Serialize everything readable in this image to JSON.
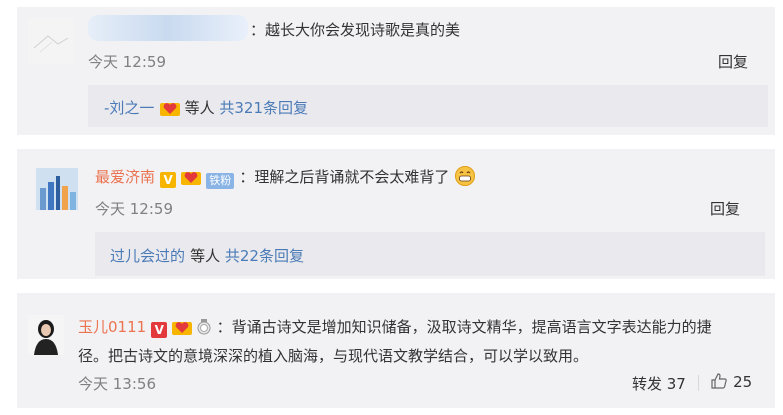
{
  "comments": [
    {
      "author": "",
      "text": "：越长大你会发现诗歌是真的美",
      "time": "今天 12:59",
      "reply_button": "回复",
      "replies_by": "-刘之一",
      "replies_mid": " 等人 ",
      "replies_count": "共321条回复"
    },
    {
      "author": "最爱济南",
      "badge_v": "V",
      "badge_fan": "铁粉",
      "text": "：理解之后背诵就不会太难背了",
      "time": "今天 12:59",
      "reply_button": "回复",
      "replies_by": "过儿会过的",
      "replies_mid": " 等人 ",
      "replies_count": "共22条回复"
    },
    {
      "author": "玉儿0111",
      "badge_v": "V",
      "text_line1": "：背诵古诗文是增加知识储备，汲取诗文精华，提高语言文字表达能力的捷",
      "text_line2": "径。把古诗文的意境深深的植入脑海，与现代语文教学结合，可以学以致用。",
      "time": "今天 13:56",
      "forward": "转发 37",
      "likes": "25"
    }
  ],
  "colors": {
    "name": "#eb7350",
    "link": "#4b7bb7",
    "card_bg": "#f2f2f5",
    "reply_bg": "#e9e9ee"
  },
  "icons": [
    "heart-badge-icon",
    "grin-emoji-icon",
    "medal-icon",
    "thumbs-up-icon"
  ]
}
